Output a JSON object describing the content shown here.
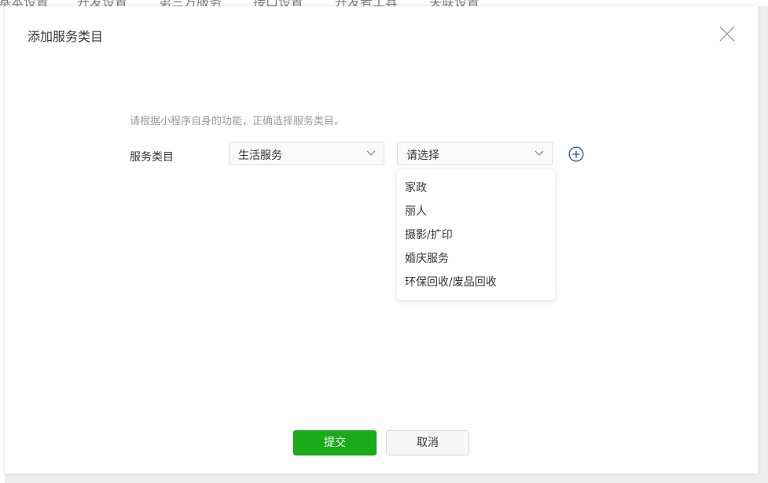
{
  "background_tabs": [
    "基本设置",
    "开发设置",
    "第三方服务",
    "接口设置",
    "开发者工具",
    "关联设置"
  ],
  "dialog": {
    "title": "添加服务类目",
    "hint": "请根据小程序自身的功能，正确选择服务类目。",
    "field_label": "服务类目",
    "primary_category": "生活服务",
    "secondary_placeholder": "请选择",
    "options": [
      "家政",
      "丽人",
      "摄影/扩印",
      "婚庆服务",
      "环保回收/废品回收"
    ],
    "submit_label": "提交",
    "cancel_label": "取消"
  },
  "icons": {
    "close": "close-icon",
    "arrow": "chevron-down-icon",
    "add": "plus-circle-icon"
  },
  "colors": {
    "primary": "#1aad19",
    "text": "#353535",
    "hint": "#9a9a9a",
    "add_icon": "#4a5a84"
  }
}
